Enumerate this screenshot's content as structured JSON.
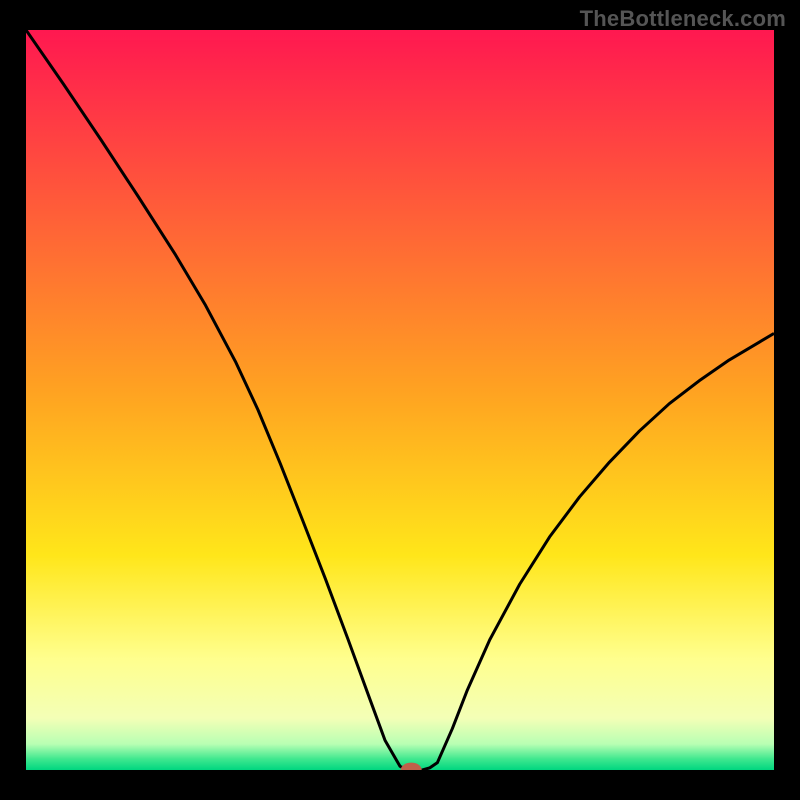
{
  "watermark": "TheBottleneck.com",
  "chart_data": {
    "type": "line",
    "title": "",
    "xlabel": "",
    "ylabel": "",
    "xlim": [
      0,
      100
    ],
    "ylim": [
      0,
      100
    ],
    "grid": false,
    "legend": false,
    "background_gradient": {
      "stops": [
        {
          "offset": 0.0,
          "color": "#ff1850"
        },
        {
          "offset": 0.49,
          "color": "#ffa321"
        },
        {
          "offset": 0.71,
          "color": "#ffe61a"
        },
        {
          "offset": 0.85,
          "color": "#ffff8e"
        },
        {
          "offset": 0.93,
          "color": "#f3ffb6"
        },
        {
          "offset": 0.965,
          "color": "#b8ffb3"
        },
        {
          "offset": 0.985,
          "color": "#40e88f"
        },
        {
          "offset": 1.0,
          "color": "#00d680"
        }
      ]
    },
    "series": [
      {
        "name": "bottleneck-curve",
        "color": "#000000",
        "x": [
          0,
          5,
          10,
          15,
          20,
          24,
          28,
          31,
          34,
          37,
          40,
          43,
          46,
          48,
          50,
          51,
          52,
          53,
          54,
          55,
          57,
          59,
          62,
          66,
          70,
          74,
          78,
          82,
          86,
          90,
          94,
          98,
          100
        ],
        "y": [
          100,
          92.7,
          85.2,
          77.5,
          69.6,
          62.8,
          55.2,
          48.7,
          41.4,
          33.7,
          25.9,
          17.8,
          9.5,
          4.0,
          0.5,
          0.0,
          0.0,
          0.0,
          0.3,
          1.0,
          5.6,
          10.8,
          17.6,
          25.1,
          31.5,
          36.9,
          41.6,
          45.8,
          49.5,
          52.6,
          55.4,
          57.8,
          59.0
        ]
      }
    ],
    "marker": {
      "x": 51.5,
      "y": 0.0,
      "color": "#c0604a",
      "rx": 1.4,
      "ry": 1.0
    }
  }
}
